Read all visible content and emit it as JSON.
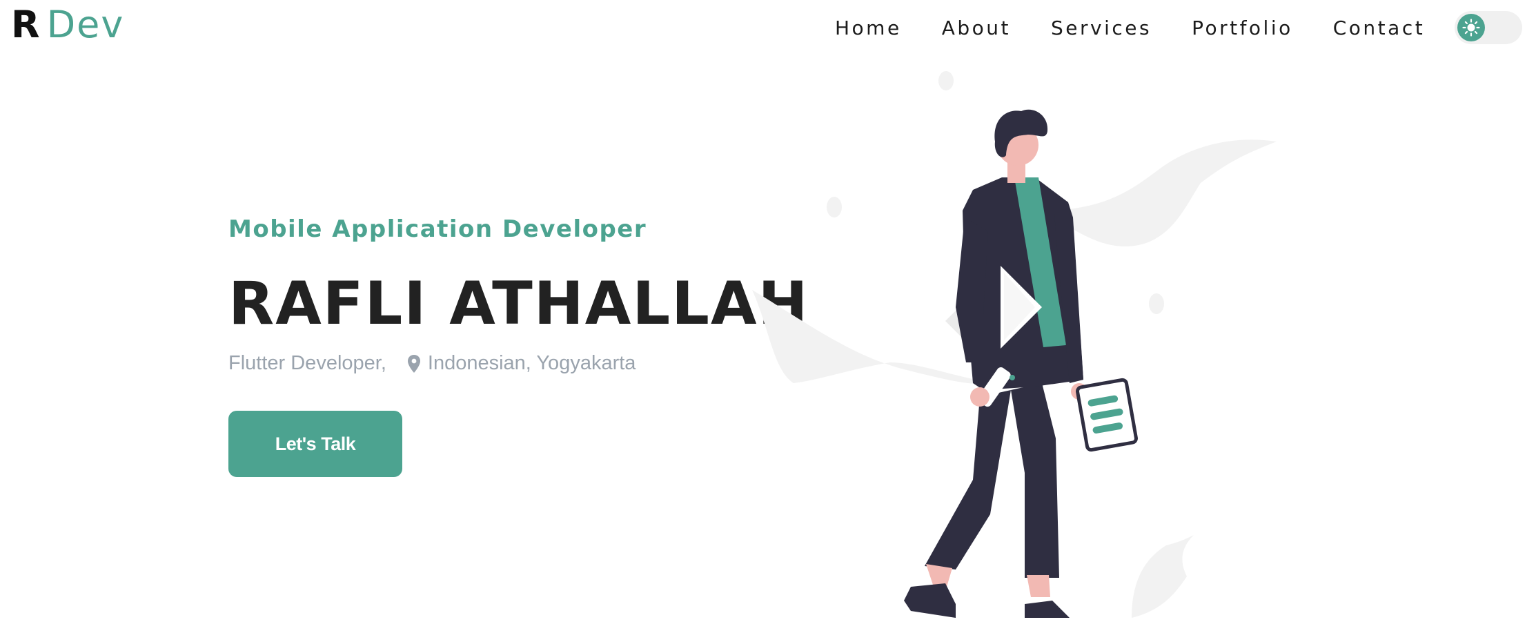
{
  "logo": {
    "initial": "R",
    "brand": "Dev"
  },
  "nav": {
    "items": [
      {
        "label": "Home"
      },
      {
        "label": "About"
      },
      {
        "label": "Services"
      },
      {
        "label": "Portfolio"
      },
      {
        "label": "Contact"
      }
    ]
  },
  "theme_toggle": {
    "icon": "sun-icon",
    "state": "light"
  },
  "hero": {
    "subtitle": "Mobile Application Developer",
    "name": "RAFLI ATHALLAH",
    "role": "Flutter Developer,",
    "location_icon": "location-pin-icon",
    "location": "Indonesian, Yogyakarta",
    "cta_label": "Let's Talk",
    "illustration": "person-walking-illustration"
  },
  "colors": {
    "accent": "#4ca390",
    "heading": "#222222",
    "muted": "#9aa3ad",
    "figure_dark": "#2f2e41",
    "skin": "#f2b9b3",
    "background_shape": "#f2f2f2"
  }
}
